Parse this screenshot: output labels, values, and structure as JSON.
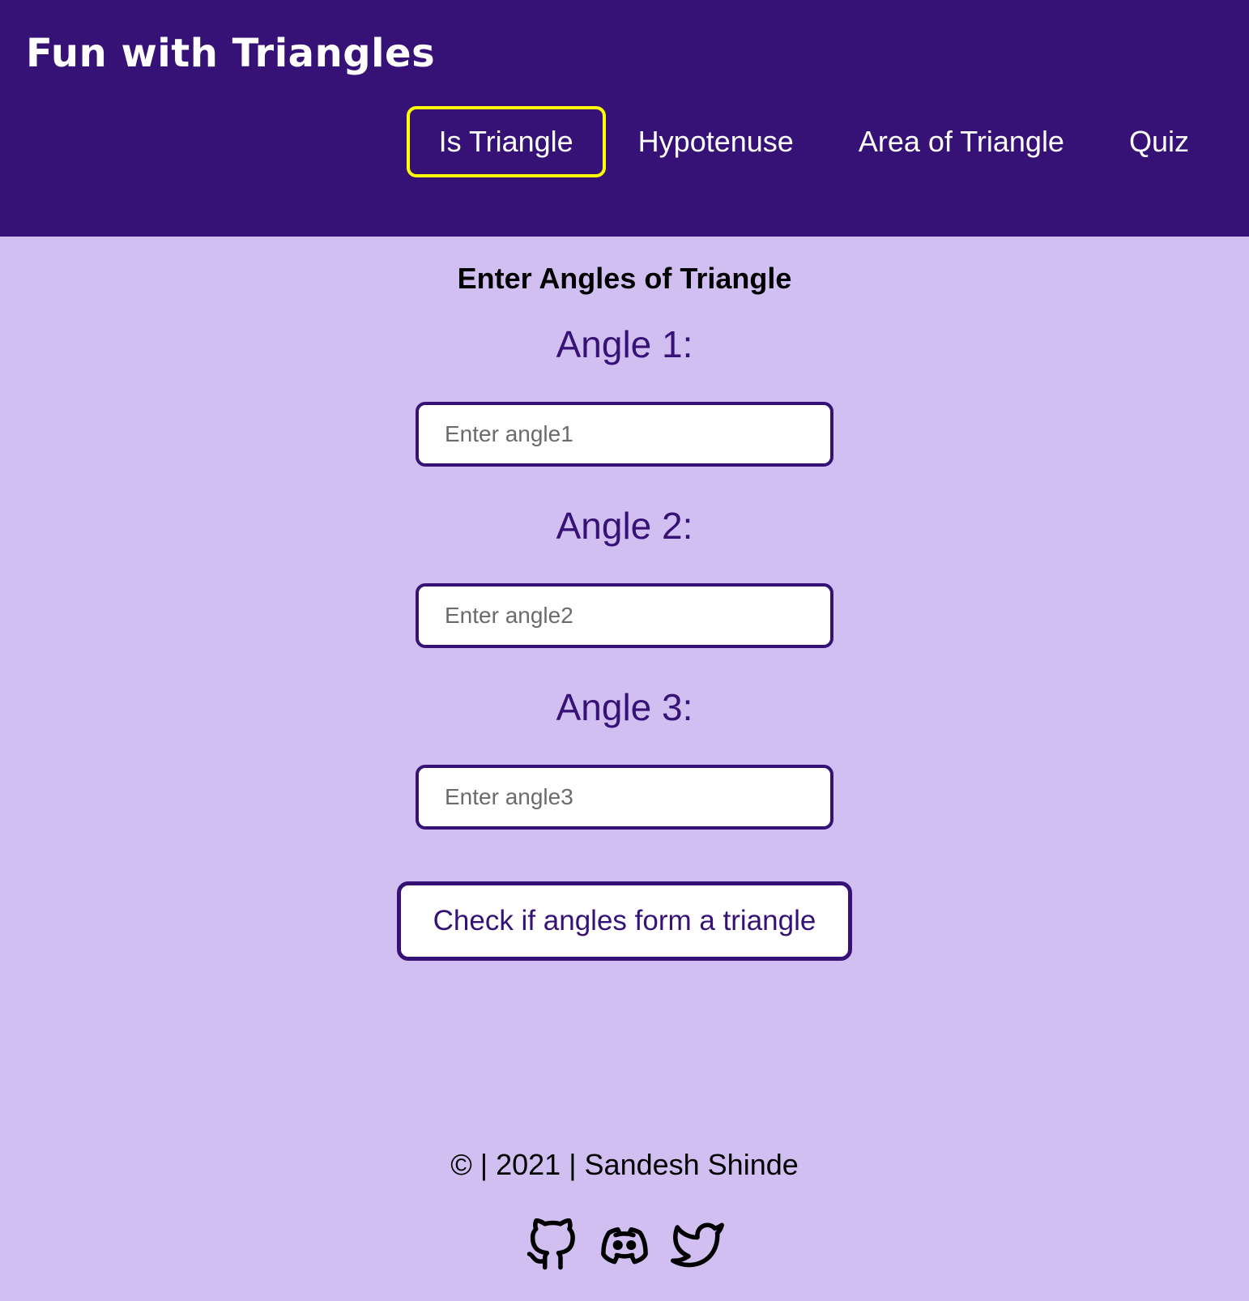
{
  "header": {
    "title": "Fun with Triangles",
    "nav": [
      {
        "label": "Is Triangle",
        "active": true
      },
      {
        "label": "Hypotenuse",
        "active": false
      },
      {
        "label": "Area of Triangle",
        "active": false
      },
      {
        "label": "Quiz",
        "active": false
      }
    ]
  },
  "main": {
    "title": "Enter Angles of Triangle",
    "angles": [
      {
        "label": "Angle 1:",
        "placeholder": "Enter angle1",
        "value": ""
      },
      {
        "label": "Angle 2:",
        "placeholder": "Enter angle2",
        "value": ""
      },
      {
        "label": "Angle 3:",
        "placeholder": "Enter angle3",
        "value": ""
      }
    ],
    "check_button": "Check if angles form a triangle"
  },
  "footer": {
    "copyright": "© | 2021 | Sandesh Shinde",
    "social": [
      "github-icon",
      "discord-icon",
      "twitter-icon"
    ]
  },
  "colors": {
    "header_bg": "#361276",
    "page_bg": "#d2bff2",
    "active_border": "#ffff00",
    "accent": "#361276"
  }
}
